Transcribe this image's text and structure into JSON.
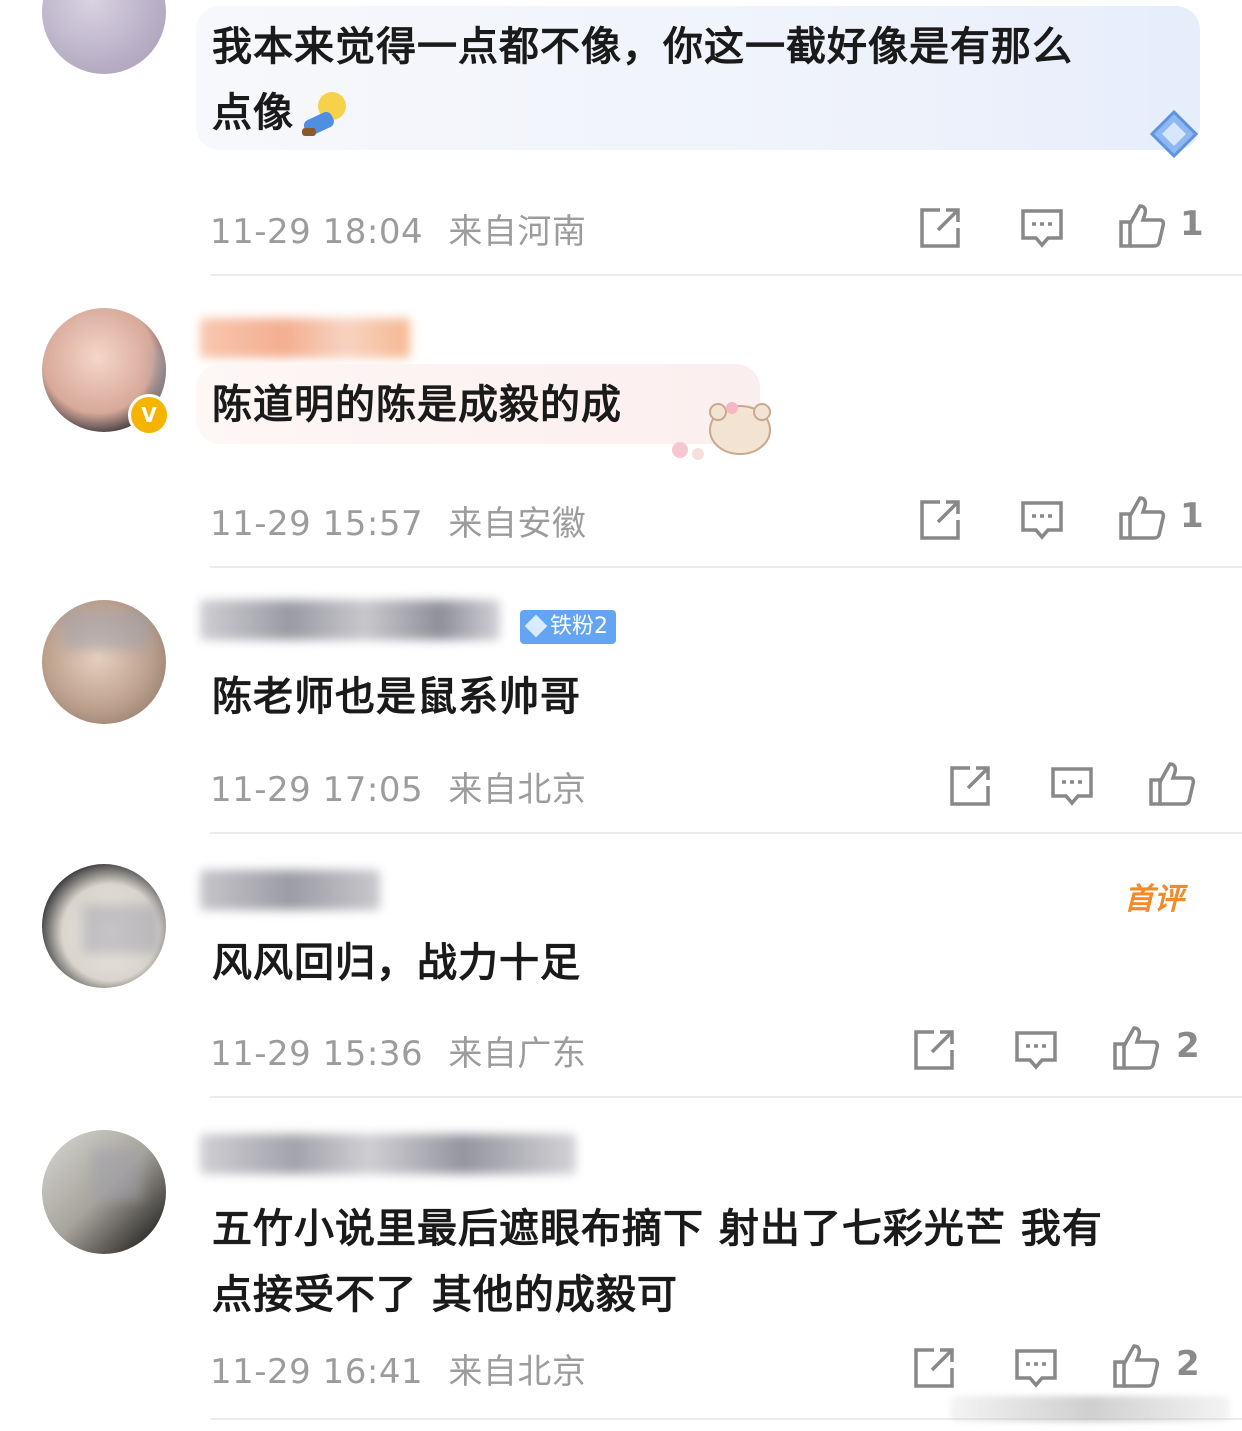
{
  "comments": [
    {
      "text_line1": "我本来觉得一点都不像，你这一截好像是有那么",
      "text_line2": "点像",
      "time": "11-29 18:04",
      "location": "来自河南",
      "likes": "1"
    },
    {
      "text_line1": "陈道明的陈是成毅的成",
      "time": "11-29 15:57",
      "location": "来自安徽",
      "likes": "1",
      "verified_icon": "v-badge-icon"
    },
    {
      "text_line1": "陈老师也是鼠系帅哥",
      "time": "11-29 17:05",
      "location": "来自北京",
      "likes": "",
      "badge": "铁粉2"
    },
    {
      "text_line1": "风风回归，战力十足",
      "time": "11-29 15:36",
      "location": "来自广东",
      "likes": "2",
      "badge": "首评"
    },
    {
      "text_line1": "五竹小说里最后遮眼布摘下 射出了七彩光芒 我有",
      "text_line2": "点接受不了 其他的成毅可",
      "time": "11-29 16:41",
      "location": "来自北京",
      "likes": "2"
    }
  ],
  "icons": {
    "share": "share-icon",
    "reply": "comment-icon",
    "like": "thumbs-up-icon"
  },
  "colors": {
    "meta_text": "#9c9c9c",
    "fan_badge": "#63a5f2",
    "first_badge": "#f08a2b"
  }
}
